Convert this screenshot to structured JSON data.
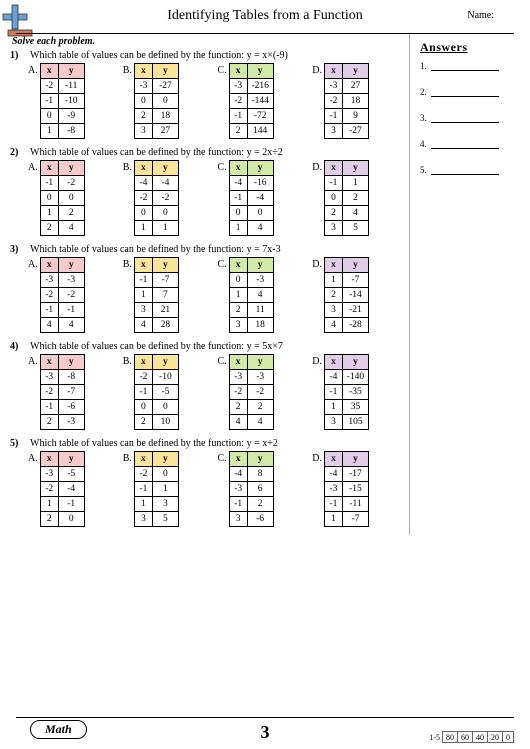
{
  "title": "Identifying Tables from a Function",
  "name_label": "Name:",
  "instruction": "Solve each problem.",
  "answers_header": "Answers",
  "answers_count": 5,
  "problems": [
    {
      "num": "1)",
      "question_prefix": "Which table of values can be defined by the function: ",
      "function": "y = x×(-9)",
      "options": [
        {
          "label": "A.",
          "hx": "x",
          "hy": "y",
          "color": "#f7caca",
          "rows": [
            [
              "-2",
              "-11"
            ],
            [
              "-1",
              "-10"
            ],
            [
              "0",
              "-9"
            ],
            [
              "1",
              "-8"
            ]
          ]
        },
        {
          "label": "B.",
          "hx": "x",
          "hy": "y",
          "color": "#fbe39a",
          "rows": [
            [
              "-3",
              "-27"
            ],
            [
              "0",
              "0"
            ],
            [
              "2",
              "18"
            ],
            [
              "3",
              "27"
            ]
          ]
        },
        {
          "label": "C.",
          "hx": "x",
          "hy": "y",
          "color": "#d2e9a7",
          "rows": [
            [
              "-3",
              "-216"
            ],
            [
              "-2",
              "-144"
            ],
            [
              "-1",
              "-72"
            ],
            [
              "2",
              "144"
            ]
          ]
        },
        {
          "label": "D.",
          "hx": "x",
          "hy": "y",
          "color": "#e1cdea",
          "rows": [
            [
              "-3",
              "27"
            ],
            [
              "-2",
              "18"
            ],
            [
              "-1",
              "9"
            ],
            [
              "3",
              "-27"
            ]
          ]
        }
      ]
    },
    {
      "num": "2)",
      "question_prefix": "Which table of values can be defined by the function: ",
      "function": "y = 2x÷2",
      "options": [
        {
          "label": "A.",
          "hx": "x",
          "hy": "y",
          "color": "#f7caca",
          "rows": [
            [
              "-1",
              "-2"
            ],
            [
              "0",
              "0"
            ],
            [
              "1",
              "2"
            ],
            [
              "2",
              "4"
            ]
          ]
        },
        {
          "label": "B.",
          "hx": "x",
          "hy": "y",
          "color": "#fbe39a",
          "rows": [
            [
              "-4",
              "-4"
            ],
            [
              "-2",
              "-2"
            ],
            [
              "0",
              "0"
            ],
            [
              "1",
              "1"
            ]
          ]
        },
        {
          "label": "C.",
          "hx": "x",
          "hy": "y",
          "color": "#d2e9a7",
          "rows": [
            [
              "-4",
              "-16"
            ],
            [
              "-1",
              "-4"
            ],
            [
              "0",
              "0"
            ],
            [
              "1",
              "4"
            ]
          ]
        },
        {
          "label": "D.",
          "hx": "x",
          "hy": "y",
          "color": "#e1cdea",
          "rows": [
            [
              "-1",
              "1"
            ],
            [
              "0",
              "2"
            ],
            [
              "2",
              "4"
            ],
            [
              "3",
              "5"
            ]
          ]
        }
      ]
    },
    {
      "num": "3)",
      "question_prefix": "Which table of values can be defined by the function: ",
      "function": "y = 7x-3",
      "options": [
        {
          "label": "A.",
          "hx": "x",
          "hy": "y",
          "color": "#f7caca",
          "rows": [
            [
              "-3",
              "-3"
            ],
            [
              "-2",
              "-2"
            ],
            [
              "-1",
              "-1"
            ],
            [
              "4",
              "4"
            ]
          ]
        },
        {
          "label": "B.",
          "hx": "x",
          "hy": "y",
          "color": "#fbe39a",
          "rows": [
            [
              "-1",
              "-7"
            ],
            [
              "1",
              "7"
            ],
            [
              "3",
              "21"
            ],
            [
              "4",
              "28"
            ]
          ]
        },
        {
          "label": "C.",
          "hx": "x",
          "hy": "y",
          "color": "#d2e9a7",
          "rows": [
            [
              "0",
              "-3"
            ],
            [
              "1",
              "4"
            ],
            [
              "2",
              "11"
            ],
            [
              "3",
              "18"
            ]
          ]
        },
        {
          "label": "D.",
          "hx": "x",
          "hy": "y",
          "color": "#e1cdea",
          "rows": [
            [
              "1",
              "-7"
            ],
            [
              "2",
              "-14"
            ],
            [
              "3",
              "-21"
            ],
            [
              "4",
              "-28"
            ]
          ]
        }
      ]
    },
    {
      "num": "4)",
      "question_prefix": "Which table of values can be defined by the function: ",
      "function": "y = 5x×7",
      "options": [
        {
          "label": "A.",
          "hx": "x",
          "hy": "y",
          "color": "#f7caca",
          "rows": [
            [
              "-3",
              "-8"
            ],
            [
              "-2",
              "-7"
            ],
            [
              "-1",
              "-6"
            ],
            [
              "2",
              "-3"
            ]
          ]
        },
        {
          "label": "B.",
          "hx": "x",
          "hy": "y",
          "color": "#fbe39a",
          "rows": [
            [
              "-2",
              "-10"
            ],
            [
              "-1",
              "-5"
            ],
            [
              "0",
              "0"
            ],
            [
              "2",
              "10"
            ]
          ]
        },
        {
          "label": "C.",
          "hx": "x",
          "hy": "y",
          "color": "#d2e9a7",
          "rows": [
            [
              "-3",
              "-3"
            ],
            [
              "-2",
              "-2"
            ],
            [
              "2",
              "2"
            ],
            [
              "4",
              "4"
            ]
          ]
        },
        {
          "label": "D.",
          "hx": "x",
          "hy": "y",
          "color": "#e1cdea",
          "rows": [
            [
              "-4",
              "-140"
            ],
            [
              "-1",
              "-35"
            ],
            [
              "1",
              "35"
            ],
            [
              "3",
              "105"
            ]
          ]
        }
      ]
    },
    {
      "num": "5)",
      "question_prefix": "Which table of values can be defined by the function: ",
      "function": "y = x+2",
      "options": [
        {
          "label": "A.",
          "hx": "x",
          "hy": "y",
          "color": "#f7caca",
          "rows": [
            [
              "-3",
              "-5"
            ],
            [
              "-2",
              "-4"
            ],
            [
              "1",
              "-1"
            ],
            [
              "2",
              "0"
            ]
          ]
        },
        {
          "label": "B.",
          "hx": "x",
          "hy": "y",
          "color": "#fbe39a",
          "rows": [
            [
              "-2",
              "0"
            ],
            [
              "-1",
              "1"
            ],
            [
              "1",
              "3"
            ],
            [
              "3",
              "5"
            ]
          ]
        },
        {
          "label": "C.",
          "hx": "x",
          "hy": "y",
          "color": "#d2e9a7",
          "rows": [
            [
              "-4",
              "8"
            ],
            [
              "-3",
              "6"
            ],
            [
              "-1",
              "2"
            ],
            [
              "3",
              "-6"
            ]
          ]
        },
        {
          "label": "D.",
          "hx": "x",
          "hy": "y",
          "color": "#e1cdea",
          "rows": [
            [
              "-4",
              "-17"
            ],
            [
              "-3",
              "-15"
            ],
            [
              "-1",
              "-11"
            ],
            [
              "1",
              "-7"
            ]
          ]
        }
      ]
    }
  ],
  "footer": {
    "brand": "Math",
    "page_number": "3",
    "range": "1-5",
    "scores": [
      "80",
      "60",
      "40",
      "20",
      "0"
    ]
  }
}
